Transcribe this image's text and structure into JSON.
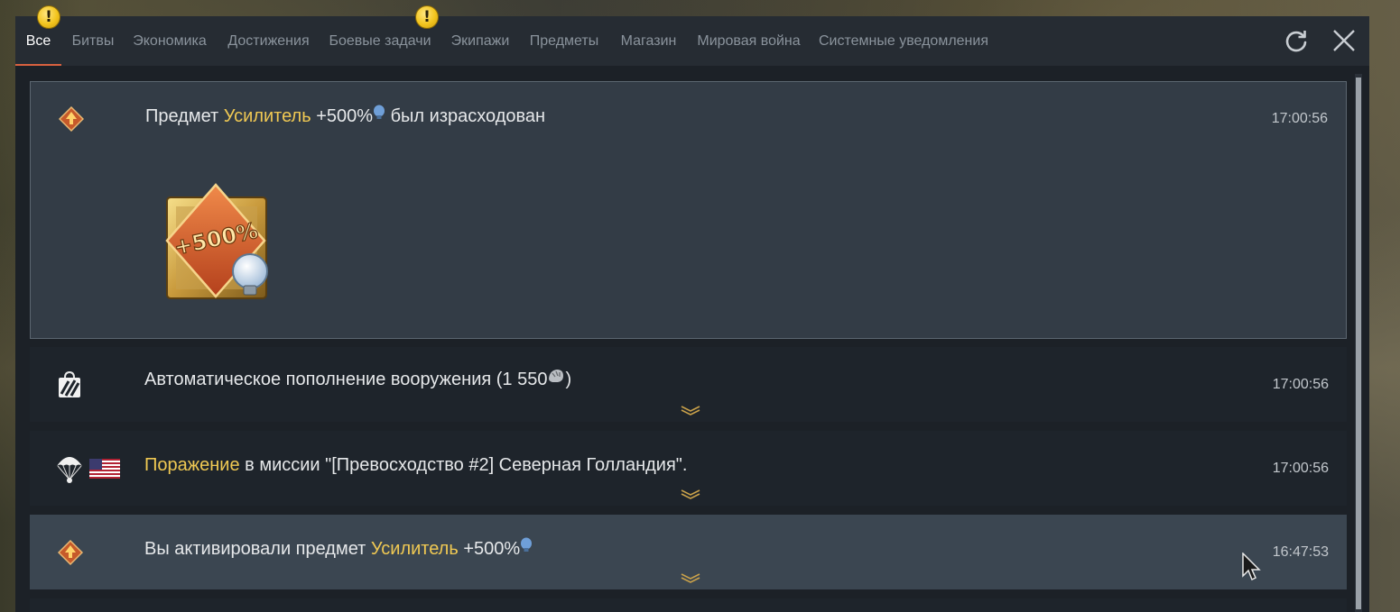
{
  "tabs": [
    {
      "label": "Все",
      "active": true,
      "alert": true
    },
    {
      "label": "Битвы"
    },
    {
      "label": "Экономика"
    },
    {
      "label": "Достижения"
    },
    {
      "label": "Боевые задачи",
      "alert": true
    },
    {
      "label": "Экипажи"
    },
    {
      "label": "Предметы"
    },
    {
      "label": "Магазин"
    },
    {
      "label": "Мировая война"
    },
    {
      "label": "Системные уведомления"
    }
  ],
  "badge_symbol": "!",
  "toolbar": {
    "refresh_icon": "refresh-icon",
    "close_icon": "close-icon"
  },
  "notifications": [
    {
      "icon": "booster-icon",
      "parts": [
        "Предмет ",
        "Усилитель",
        " +500%",
        " был израсходован"
      ],
      "time": "17:00:56",
      "expanded": true,
      "card_text": "+500%"
    },
    {
      "icon": "repair-bag-icon",
      "parts": [
        "Автоматическое пополнение вооружения (1 550",
        ")"
      ],
      "time": "17:00:56"
    },
    {
      "icon": "parachute-icon",
      "flag": "usa-flag-icon",
      "parts": [
        "Поражение",
        " в миссии \"[Превосходство #2] Северная Голландия\"."
      ],
      "time": "17:00:56"
    },
    {
      "icon": "booster-icon",
      "parts": [
        "Вы активировали предмет ",
        "Усилитель",
        " +500%"
      ],
      "time": "16:47:53",
      "highlight": true
    }
  ],
  "colors": {
    "accent_tab": "#d8613f",
    "gold_text": "#f0c953",
    "research_point": "#6f9fd8"
  }
}
